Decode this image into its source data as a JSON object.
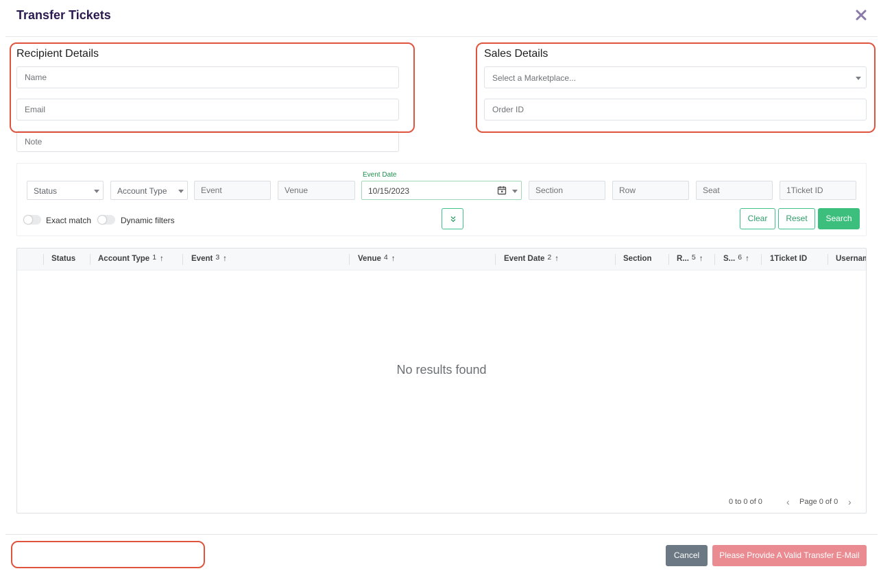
{
  "modal": {
    "title": "Transfer Tickets"
  },
  "recipient": {
    "heading": "Recipient Details",
    "name_placeholder": "Name",
    "email_placeholder": "Email",
    "note_placeholder": "Note"
  },
  "sales": {
    "heading": "Sales Details",
    "marketplace_placeholder": "Select a Marketplace...",
    "order_id_placeholder": "Order ID"
  },
  "filters": {
    "status": "Status",
    "account_type": "Account Type",
    "event_placeholder": "Event",
    "venue_placeholder": "Venue",
    "event_date_label": "Event Date",
    "event_date_value": "10/15/2023",
    "section_placeholder": "Section",
    "row_placeholder": "Row",
    "seat_placeholder": "Seat",
    "ticket_id_placeholder": "1Ticket ID",
    "exact_match_label": "Exact match",
    "dynamic_filters_label": "Dynamic filters",
    "clear_label": "Clear",
    "reset_label": "Reset",
    "search_label": "Search"
  },
  "grid": {
    "columns": [
      {
        "label": "Status",
        "sort_order": "",
        "arrow": ""
      },
      {
        "label": "Account Type",
        "sort_order": "1",
        "arrow": "↑"
      },
      {
        "label": "Event",
        "sort_order": "3",
        "arrow": "↑"
      },
      {
        "label": "Venue",
        "sort_order": "4",
        "arrow": "↑"
      },
      {
        "label": "Event Date",
        "sort_order": "2",
        "arrow": "↑"
      },
      {
        "label": "Section",
        "sort_order": "",
        "arrow": ""
      },
      {
        "label": "R...",
        "sort_order": "5",
        "arrow": "↑"
      },
      {
        "label": "S...",
        "sort_order": "6",
        "arrow": "↑"
      },
      {
        "label": "1Ticket ID",
        "sort_order": "",
        "arrow": ""
      },
      {
        "label": "Usernam",
        "sort_order": "",
        "arrow": ""
      }
    ],
    "empty_message": "No results found",
    "range_text": "0 to 0 of 0",
    "page_text": "Page 0 of 0"
  },
  "footer": {
    "cancel_label": "Cancel",
    "submit_label": "Please Provide A Valid Transfer E-Mail"
  },
  "colors": {
    "title": "#2b1a4f",
    "accent_green": "#3cbf7d",
    "annotation_red": "#e0533d",
    "cancel_gray": "#6c7883",
    "submit_pink": "#e98b91"
  },
  "icons": {
    "close": "close-icon",
    "calendar": "calendar-icon",
    "expand": "double-chevron-down-icon",
    "pager_prev": "chevron-left-icon",
    "pager_next": "chevron-right-icon"
  }
}
